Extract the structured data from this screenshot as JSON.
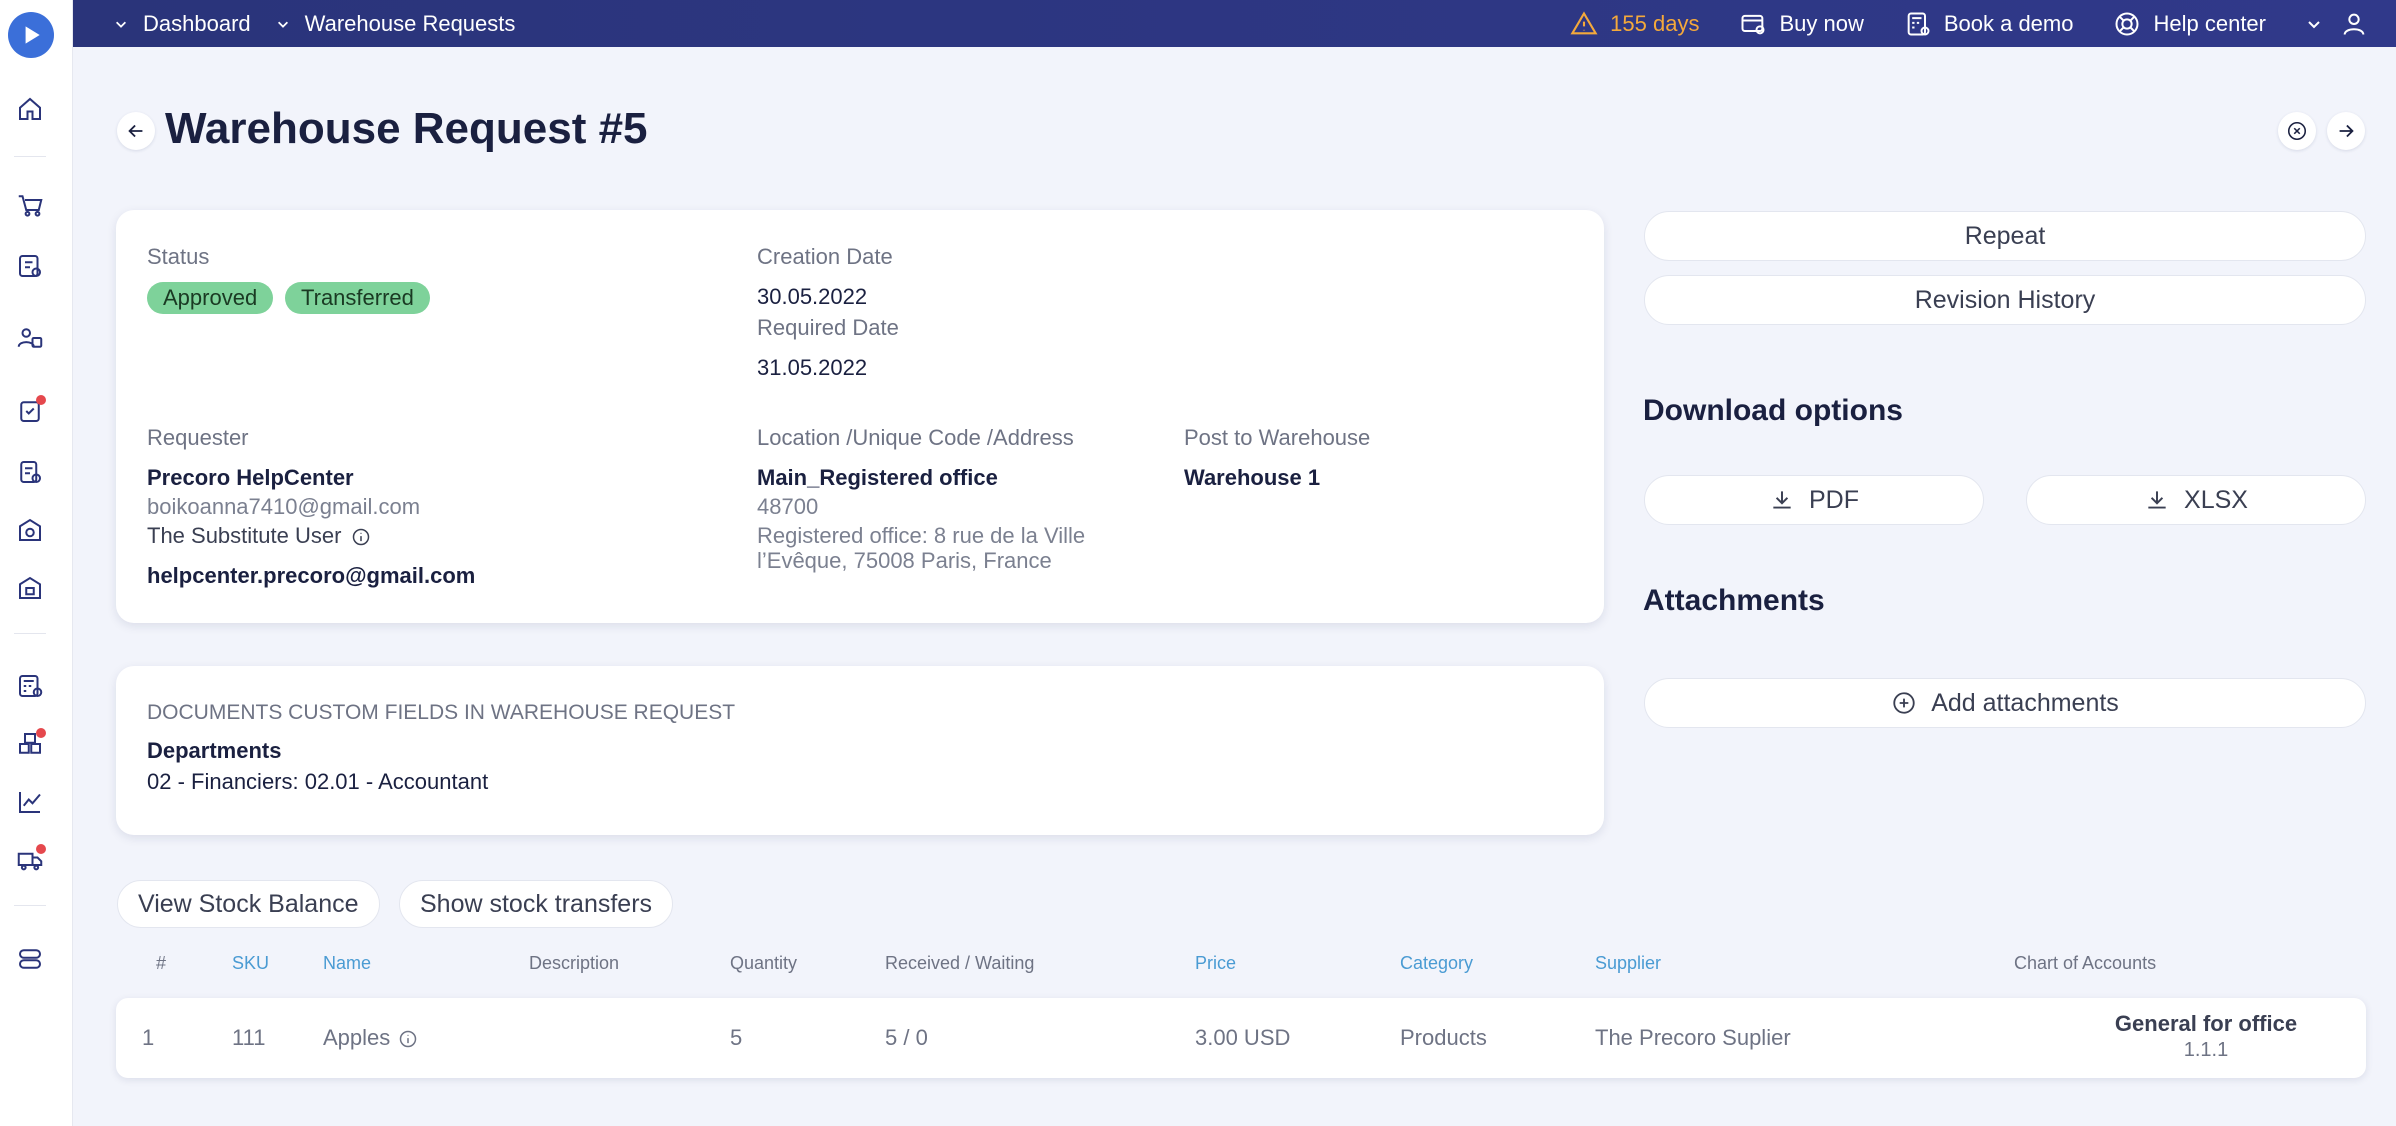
{
  "topbar": {
    "crumbs": [
      "Dashboard",
      "Warehouse Requests"
    ],
    "trial": "155 days",
    "buy_now": "Buy now",
    "book_demo": "Book a demo",
    "help_center": "Help center"
  },
  "page": {
    "title": "Warehouse Request #5"
  },
  "details": {
    "status_label": "Status",
    "badges": [
      "Approved",
      "Transferred"
    ],
    "creation_label": "Creation Date",
    "creation_value": "30.05.2022",
    "required_label": "Required Date",
    "required_value": "31.05.2022",
    "requester_label": "Requester",
    "requester_name": "Precoro HelpCenter",
    "requester_email": "boikoanna7410@gmail.com",
    "substitute_label": "The Substitute User",
    "substitute_email": "helpcenter.precoro@gmail.com",
    "location_label": "Location /Unique Code /Address",
    "location_name": "Main_Registered office",
    "location_code": "48700",
    "location_address_1": "Registered office: 8 rue de la Ville",
    "location_address_2": "l’Evêque, 75008 Paris, France",
    "warehouse_label": "Post to Warehouse",
    "warehouse_value": "Warehouse 1"
  },
  "custom_fields": {
    "heading": "DOCUMENTS CUSTOM FIELDS IN WAREHOUSE REQUEST",
    "field_label": "Departments",
    "field_value": "02 - Financiers: 02.01 - Accountant"
  },
  "actions": {
    "repeat": "Repeat",
    "revision_history": "Revision History",
    "download_heading": "Download options",
    "pdf": "PDF",
    "xlsx": "XLSX",
    "attachments_heading": "Attachments",
    "add_attachments": "Add attachments"
  },
  "stock": {
    "view_balance": "View Stock Balance",
    "show_transfers": "Show stock transfers"
  },
  "table": {
    "headers": {
      "num": "#",
      "sku": "SKU",
      "name": "Name",
      "description": "Description",
      "quantity": "Quantity",
      "received": "Received / Waiting",
      "price": "Price",
      "category": "Category",
      "supplier": "Supplier",
      "coa": "Chart of Accounts"
    },
    "rows": [
      {
        "num": "1",
        "sku": "111",
        "name": "Apples",
        "description": "",
        "quantity": "5",
        "received": "5 / 0",
        "price": "3.00 USD",
        "category": "Products",
        "supplier": "The Precoro Suplier",
        "coa_name": "General for office",
        "coa_code": "1.1.1"
      }
    ]
  },
  "colors": {
    "topbar": "#2a347a",
    "badge": "#7ed29a",
    "warning": "#f4a93b",
    "link": "#4a9bd3"
  }
}
